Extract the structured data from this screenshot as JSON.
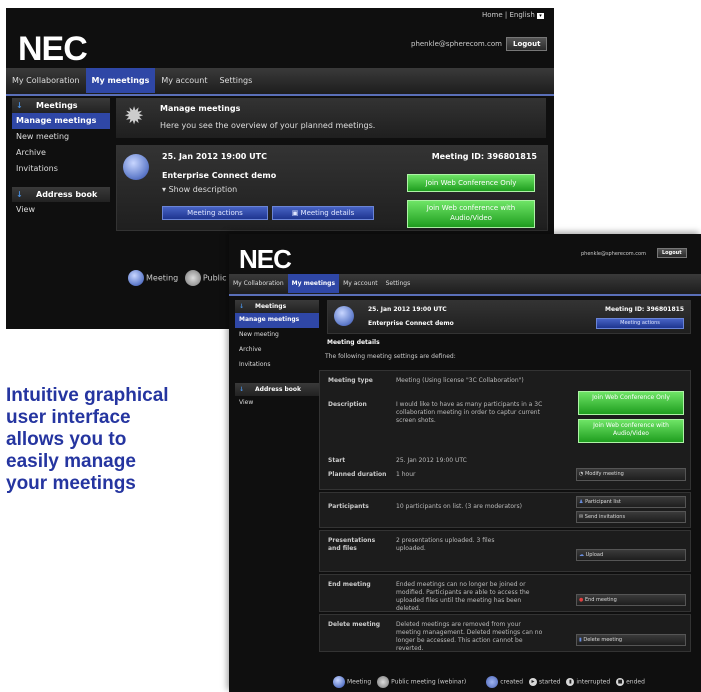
{
  "caption": {
    "lines": [
      "Intuitive graphical",
      "user interface",
      "allows you to",
      "easily manage",
      "your meetings"
    ]
  },
  "screen1": {
    "top_links": "Home | English",
    "logo": "NEC",
    "user_email": "phenkle@spherecom.com",
    "logout": "Logout",
    "nav": [
      "My Collaboration",
      "My meetings",
      "My account",
      "Settings"
    ],
    "sidebar": {
      "meetings_header": "Meetings",
      "items": [
        "Manage meetings",
        "New meeting",
        "Archive",
        "Invitations"
      ],
      "address_header": "Address book",
      "address_items": [
        "View"
      ]
    },
    "header": {
      "title": "Manage meetings",
      "subtitle": "Here you see the overview of your planned meetings."
    },
    "meeting": {
      "date": "25. Jan 2012 19:00 UTC",
      "id": "Meeting ID: 396801815",
      "name": "Enterprise Connect demo",
      "show_description": "Show description",
      "join_only": "Join Web Conference Only",
      "join_av": "Join Web conference with Audio/Video",
      "actions": "Meeting actions",
      "details": "Meeting details"
    },
    "legend": [
      "Meeting",
      "Public"
    ]
  },
  "screen2": {
    "logo": "NEC",
    "user_email": "phenkle@spherecom.com",
    "logout": "Logout",
    "nav": [
      "My Collaboration",
      "My meetings",
      "My account",
      "Settings"
    ],
    "sidebar": {
      "meetings_header": "Meetings",
      "items": [
        "Manage meetings",
        "New meeting",
        "Archive",
        "Invitations"
      ],
      "address_header": "Address book",
      "address_items": [
        "View"
      ]
    },
    "meeting": {
      "date": "25. Jan 2012 19:00 UTC",
      "id": "Meeting ID: 396801815",
      "name": "Enterprise Connect demo",
      "actions": "Meeting actions"
    },
    "details": {
      "title": "Meeting details",
      "intro": "The following meeting settings are defined:",
      "meeting_type_label": "Meeting type",
      "meeting_type_value": "Meeting (Using license \"3C Collaboration\")",
      "description_label": "Description",
      "description_value": "I would like to have as many participants in a 3C collaboration meeting in order to captur current screen shots.",
      "join_only": "Join Web Conference Only",
      "join_av": "Join Web conference with Audio/Video",
      "start_label": "Start",
      "start_value": "25. Jan 2012 19:00 UTC",
      "duration_label": "Planned duration",
      "duration_value": "1 hour",
      "modify": "Modify meeting",
      "participants_label": "Participants",
      "participants_value": "10 participants on list. (3 are moderators)",
      "participant_list": "Participant list",
      "send_invitations": "Send invitations",
      "presentations_label": "Presentations and files",
      "presentations_value": "2 presentations uploaded. 3 files uploaded.",
      "upload": "Upload",
      "end_label": "End meeting",
      "end_value": "Ended meetings can no longer be joined or modified. Participants are able to access the uploaded files until the meeting has been deleted.",
      "end_button": "End meeting",
      "delete_label": "Delete meeting",
      "delete_value": "Deleted meetings are removed from your meeting management. Deleted meetings can no longer be accessed. This action cannot be reverted.",
      "delete_button": "Delete meeting"
    },
    "legend": [
      "Meeting",
      "Public meeting (webinar)",
      "created",
      "started",
      "interrupted",
      "ended"
    ]
  },
  "colors": {
    "accent_blue": "#2f47a6",
    "join_green": "#3cc23a",
    "caption_blue": "#2535a0"
  }
}
